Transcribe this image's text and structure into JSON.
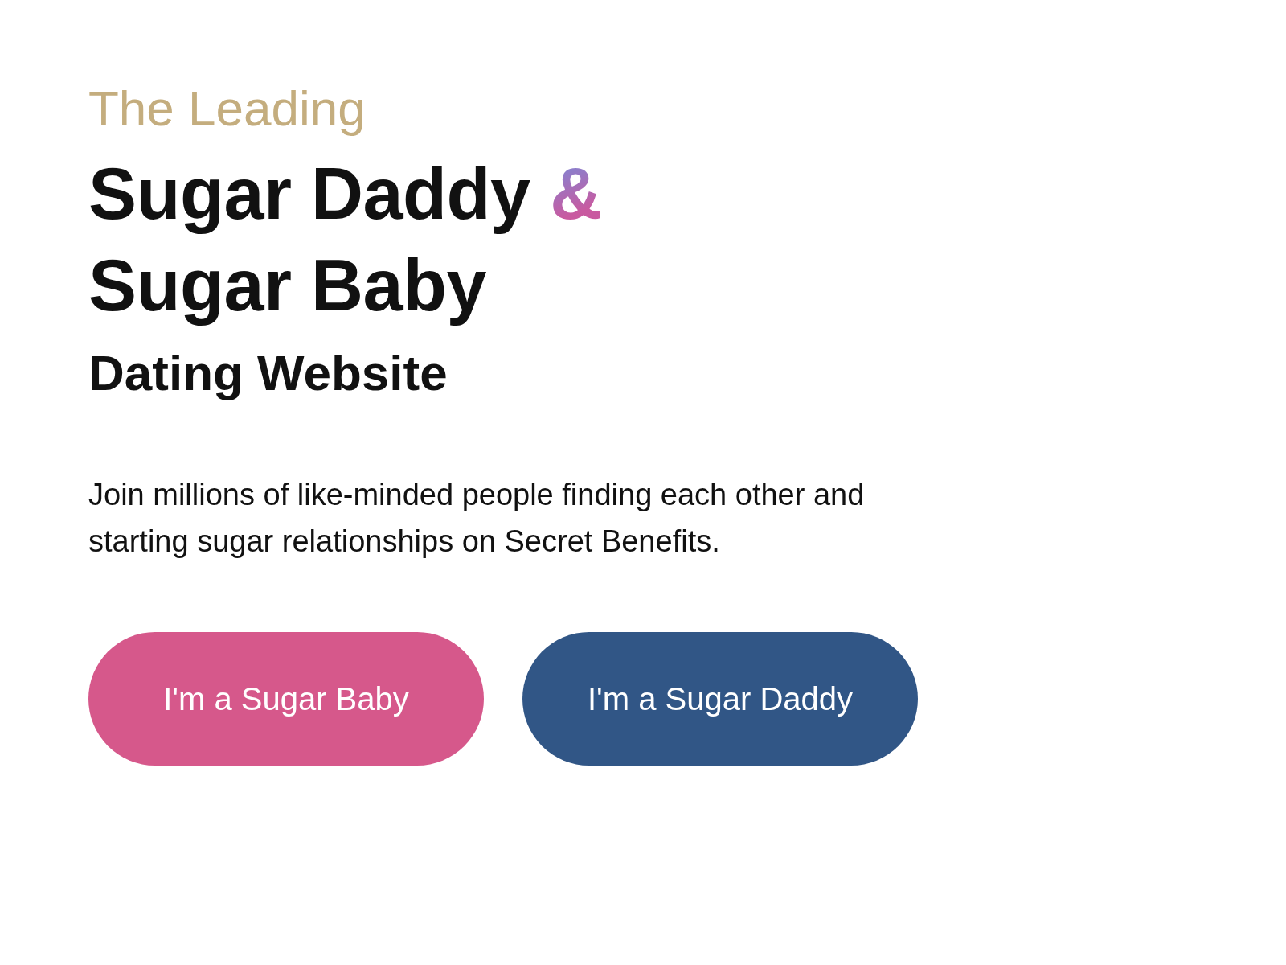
{
  "kicker": "The Leading",
  "headline": {
    "line_1": "Sugar Daddy",
    "ampersand": "&",
    "line_2": "Sugar Baby"
  },
  "subheadline": "Dating Website",
  "description": "Join millions of like-minded people finding each other and starting sugar relationships on Secret Benefits.",
  "buttons": [
    {
      "label": "I'm a Sugar Baby",
      "kind": "baby"
    },
    {
      "label": "I'm a Sugar Daddy",
      "kind": "daddy"
    }
  ]
}
